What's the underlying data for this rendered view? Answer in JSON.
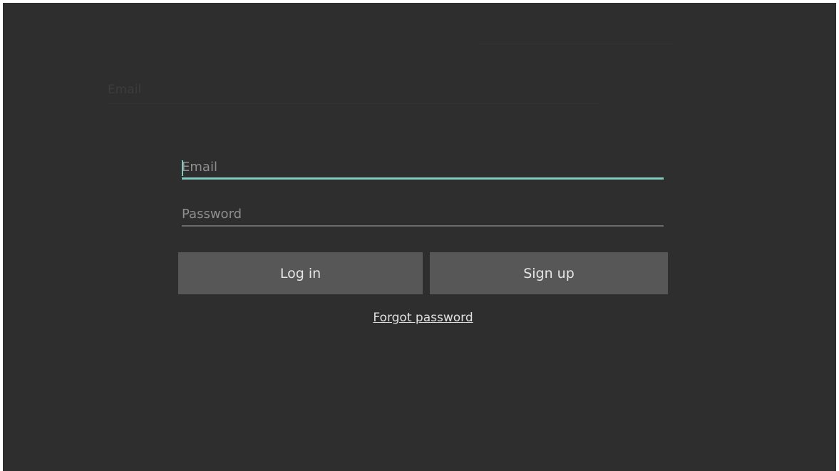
{
  "background_ghost": {
    "label": "Email"
  },
  "form": {
    "email_placeholder": "Email",
    "password_placeholder": "Password",
    "login_label": "Log in",
    "signup_label": "Sign up",
    "forgot_label": "Forgot password"
  },
  "colors": {
    "background": "#2e2e2e",
    "accent": "#7fc9bf",
    "button": "#575757"
  }
}
